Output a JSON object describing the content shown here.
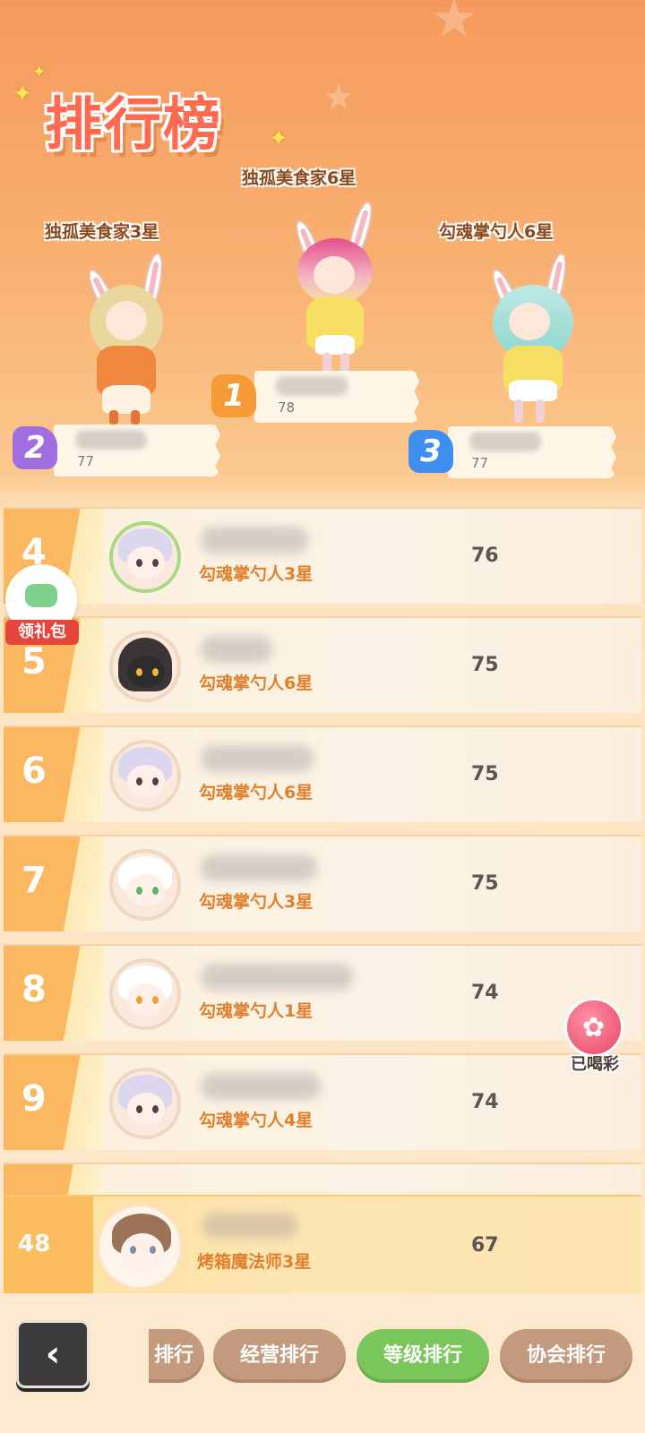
{
  "header": {
    "title": "排行榜"
  },
  "podium": [
    {
      "rank": "1",
      "title": "独孤美食家6星",
      "score": "78",
      "badge_color": "#f59a35"
    },
    {
      "rank": "2",
      "title": "独孤美食家3星",
      "score": "77",
      "badge_color": "#a06ee0"
    },
    {
      "rank": "3",
      "title": "勾魂掌勺人6星",
      "score": "77",
      "badge_color": "#3f8ff0"
    }
  ],
  "list": [
    {
      "rank": "4",
      "title": "勾魂掌勺人3星",
      "score": "76"
    },
    {
      "rank": "5",
      "title": "勾魂掌勺人6星",
      "score": "75"
    },
    {
      "rank": "6",
      "title": "勾魂掌勺人6星",
      "score": "75"
    },
    {
      "rank": "7",
      "title": "勾魂掌勺人3星",
      "score": "75"
    },
    {
      "rank": "8",
      "title": "勾魂掌勺人1星",
      "score": "74"
    },
    {
      "rank": "9",
      "title": "勾魂掌勺人4星",
      "score": "74"
    }
  ],
  "self": {
    "rank": "48",
    "title": "烤箱魔法师3星",
    "score": "67"
  },
  "floats": {
    "gift_label": "领礼包",
    "cheer_label": "已喝彩"
  },
  "tabs": [
    {
      "label": "排行",
      "active": false
    },
    {
      "label": "经营排行",
      "active": false
    },
    {
      "label": "等级排行",
      "active": true
    },
    {
      "label": "协会排行",
      "active": false
    }
  ],
  "icons": {
    "back": "back-arrow-icon",
    "gift": "gamepad-icon",
    "cheer": "party-popper-icon"
  }
}
